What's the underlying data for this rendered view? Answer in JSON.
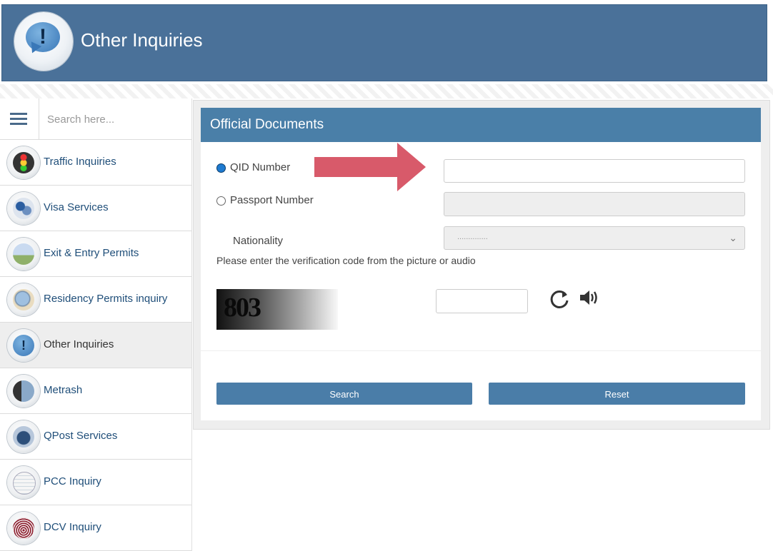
{
  "header": {
    "title": "Other Inquiries",
    "logo_icon": "info-bubble-icon"
  },
  "sidebar": {
    "search_placeholder": "Search here...",
    "items": [
      {
        "label": "Traffic Inquiries",
        "icon": "traffic-light-icon"
      },
      {
        "label": "Visa Services",
        "icon": "visa-stamp-icon"
      },
      {
        "label": "Exit & Entry Permits",
        "icon": "airplane-icon"
      },
      {
        "label": "Residency Permits inquiry",
        "icon": "magnifier-globe-icon"
      },
      {
        "label": "Other Inquiries",
        "icon": "info-bubble-icon",
        "active": true
      },
      {
        "label": "Metrash",
        "icon": "phone-user-icon"
      },
      {
        "label": "QPost Services",
        "icon": "delivery-truck-icon"
      },
      {
        "label": "PCC Inquiry",
        "icon": "certificate-icon"
      },
      {
        "label": "DCV Inquiry",
        "icon": "fingerprint-icon"
      }
    ]
  },
  "panel": {
    "title": "Official Documents",
    "qid_label": "QID Number",
    "qid_value": "",
    "passport_label": "Passport Number",
    "passport_value": "",
    "nationality_label": "Nationality",
    "nationality_value": "..............",
    "verification_prompt": "Please enter the verification code from the picture or audio",
    "captcha_text": "803",
    "captcha_value": "",
    "search_button": "Search",
    "reset_button": "Reset"
  },
  "colors": {
    "header_bg": "#4a7199",
    "panel_title_bg": "#4a7fa8",
    "button_bg": "#4a7da8",
    "annotation_arrow": "#d85a6a",
    "nav_text": "#1f4e79"
  }
}
